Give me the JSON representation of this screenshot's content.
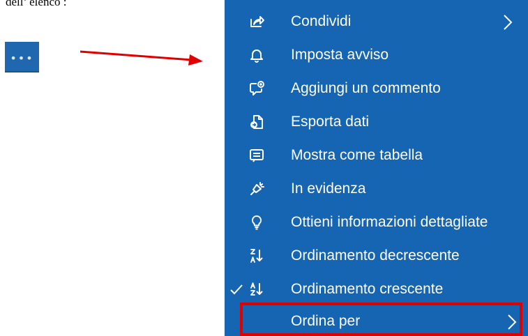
{
  "caption": "dell’ elenco :",
  "more_button": {
    "icon": "more-horizontal-icon",
    "glyph": "•••"
  },
  "annotation": {
    "arrow_color": "#e00000",
    "highlight_color": "#e00000"
  },
  "menu": {
    "background": "#1565b3",
    "items": [
      {
        "label": "Condividi",
        "icon": "share-icon",
        "has_submenu": true,
        "checked": false
      },
      {
        "label": "Imposta avviso",
        "icon": "bell-icon",
        "has_submenu": false,
        "checked": false
      },
      {
        "label": "Aggiungi un commento",
        "icon": "comment-add-icon",
        "has_submenu": false,
        "checked": false
      },
      {
        "label": "Esporta dati",
        "icon": "export-icon",
        "has_submenu": false,
        "checked": false
      },
      {
        "label": "Mostra come tabella",
        "icon": "table-icon",
        "has_submenu": false,
        "checked": false
      },
      {
        "label": "In evidenza",
        "icon": "spotlight-icon",
        "has_submenu": false,
        "checked": false
      },
      {
        "label": "Ottieni informazioni dettagliate",
        "icon": "lightbulb-icon",
        "has_submenu": false,
        "checked": false
      },
      {
        "label": "Ordinamento decrescente",
        "icon": "sort-descending-icon",
        "has_submenu": false,
        "checked": false
      },
      {
        "label": "Ordinamento crescente",
        "icon": "sort-ascending-icon",
        "has_submenu": false,
        "checked": true
      },
      {
        "label": "Ordina per",
        "icon": "",
        "has_submenu": true,
        "checked": false
      }
    ]
  }
}
